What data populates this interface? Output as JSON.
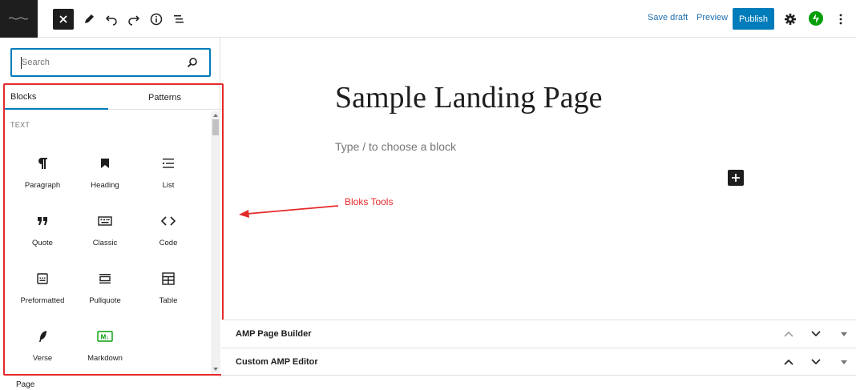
{
  "header": {
    "save_draft": "Save draft",
    "preview": "Preview",
    "publish": "Publish",
    "accent_color": "#007cba"
  },
  "inserter": {
    "search_placeholder": "Search",
    "tabs": [
      {
        "label": "Blocks",
        "active": true
      },
      {
        "label": "Patterns",
        "active": false
      }
    ],
    "category": "TEXT",
    "blocks": [
      {
        "label": "Paragraph",
        "icon": "paragraph-icon"
      },
      {
        "label": "Heading",
        "icon": "heading-icon"
      },
      {
        "label": "List",
        "icon": "list-icon"
      },
      {
        "label": "Quote",
        "icon": "quote-icon"
      },
      {
        "label": "Classic",
        "icon": "keyboard-icon"
      },
      {
        "label": "Code",
        "icon": "code-icon"
      },
      {
        "label": "Preformatted",
        "icon": "preformatted-icon"
      },
      {
        "label": "Pullquote",
        "icon": "pullquote-icon"
      },
      {
        "label": "Table",
        "icon": "table-icon"
      },
      {
        "label": "Verse",
        "icon": "feather-icon"
      },
      {
        "label": "Markdown",
        "icon": "markdown-icon"
      }
    ]
  },
  "footer": {
    "breadcrumb": "Page"
  },
  "canvas": {
    "title": "Sample Landing Page",
    "placeholder": "Type / to choose a block"
  },
  "annotation": {
    "text": "Bloks Tools",
    "color": "#e52a2a"
  },
  "metaboxes": [
    {
      "title": "AMP Page Builder"
    },
    {
      "title": "Custom AMP Editor"
    }
  ]
}
